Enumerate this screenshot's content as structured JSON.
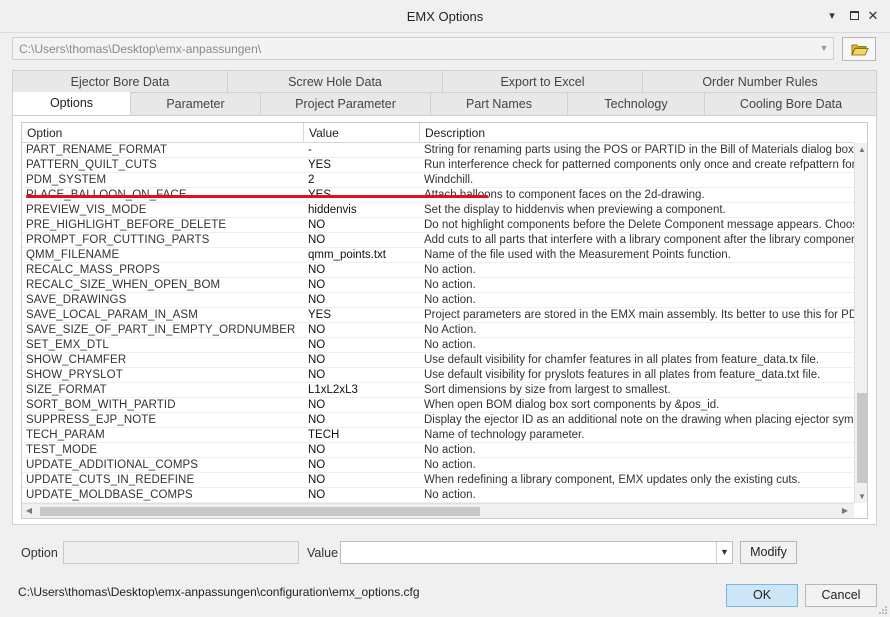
{
  "window": {
    "title": "EMX Options"
  },
  "path_selector": {
    "value": "C:\\Users\\thomas\\Desktop\\emx-anpassungen\\"
  },
  "tabs_back": [
    "Ejector Bore Data",
    "Screw Hole Data",
    "Export to Excel",
    "Order Number Rules"
  ],
  "tabs_front": [
    "Options",
    "Parameter",
    "Project Parameter",
    "Part Names",
    "Technology",
    "Cooling Bore Data"
  ],
  "active_tab": "Options",
  "table": {
    "columns": [
      "Option",
      "Value",
      "Description"
    ],
    "rows": [
      {
        "option": "PART_RENAME_FORMAT",
        "value": "-",
        "description": "String for renaming parts using the POS or PARTID in the Bill of Materials dialog box."
      },
      {
        "option": "PATTERN_QUILT_CUTS",
        "value": "YES",
        "description": "Run interference check for patterned components only once and create refpattern for cuts."
      },
      {
        "option": "PDM_SYSTEM",
        "value": "2",
        "description": "Windchill."
      },
      {
        "option": "PLACE_BALLOON_ON_FACE",
        "value": "YES",
        "description": "Attach balloons to component faces on the 2d-drawing."
      },
      {
        "option": "PREVIEW_VIS_MODE",
        "value": "hiddenvis",
        "description": "Set the display to hiddenvis when previewing a component."
      },
      {
        "option": "PRE_HIGHLIGHT_BEFORE_DELETE",
        "value": "NO",
        "description": "Do not highlight components before the Delete Component message appears. Choose YES to highlight."
      },
      {
        "option": "PROMPT_FOR_CUTTING_PARTS",
        "value": "NO",
        "description": "Add cuts to all parts that interfere with a library component after the library component is placed."
      },
      {
        "option": "QMM_FILENAME",
        "value": "qmm_points.txt",
        "description": "Name of the file used with the Measurement Points function."
      },
      {
        "option": "RECALC_MASS_PROPS",
        "value": "NO",
        "description": "No action."
      },
      {
        "option": "RECALC_SIZE_WHEN_OPEN_BOM",
        "value": "NO",
        "description": "No action."
      },
      {
        "option": "SAVE_DRAWINGS",
        "value": "NO",
        "description": "No action."
      },
      {
        "option": "SAVE_LOCAL_PARAM_IN_ASM",
        "value": "YES",
        "description": "Project parameters are stored in the EMX main assembly. Its better to use this for PDM systems."
      },
      {
        "option": "SAVE_SIZE_OF_PART_IN_EMPTY_ORDNUMBER",
        "value": "NO",
        "description": "No Action."
      },
      {
        "option": "SET_EMX_DTL",
        "value": "NO",
        "description": "No action."
      },
      {
        "option": "SHOW_CHAMFER",
        "value": "NO",
        "description": "Use default visibility for chamfer features in all plates from feature_data.tx file."
      },
      {
        "option": "SHOW_PRYSLOT",
        "value": "NO",
        "description": "Use default visibility for pryslots features in all plates from feature_data.txt file."
      },
      {
        "option": "SIZE_FORMAT",
        "value": "L1xL2xL3",
        "description": "Sort dimensions by size from largest to smallest."
      },
      {
        "option": "SORT_BOM_WITH_PARTID",
        "value": "NO",
        "description": "When open BOM dialog box sort components by &pos_id."
      },
      {
        "option": "SUPPRESS_EJP_NOTE",
        "value": "NO",
        "description": "Display the ejector ID as an additional note on the drawing when placing ejector symbols."
      },
      {
        "option": "TECH_PARAM",
        "value": "TECH",
        "description": "Name of technology parameter."
      },
      {
        "option": "TEST_MODE",
        "value": "NO",
        "description": "No action."
      },
      {
        "option": "UPDATE_ADDITIONAL_COMPS",
        "value": "NO",
        "description": "No action."
      },
      {
        "option": "UPDATE_CUTS_IN_REDEFINE",
        "value": "NO",
        "description": "When redefining a library component, EMX updates only the existing cuts."
      },
      {
        "option": "UPDATE_MOLDBASE_COMPS",
        "value": "NO",
        "description": "No action."
      }
    ]
  },
  "editor": {
    "option_label": "Option",
    "option_value": "",
    "value_label": "Value",
    "value_value": "",
    "modify_label": "Modify"
  },
  "footer": {
    "config_path": "C:\\Users\\thomas\\Desktop\\emx-anpassungen\\configuration\\emx_options.cfg",
    "ok_label": "OK",
    "cancel_label": "Cancel"
  },
  "colors": {
    "highlight_line": "#e0101c",
    "ok_button": "#cde6f7"
  },
  "icons": [
    "window-menu-icon",
    "maximize-icon",
    "close-icon",
    "folder-open-icon",
    "dropdown-arrow-icon",
    "scroll-up-arrow-icon",
    "scroll-down-arrow-icon",
    "scroll-left-arrow-icon",
    "scroll-right-arrow-icon",
    "resize-grip-icon"
  ]
}
